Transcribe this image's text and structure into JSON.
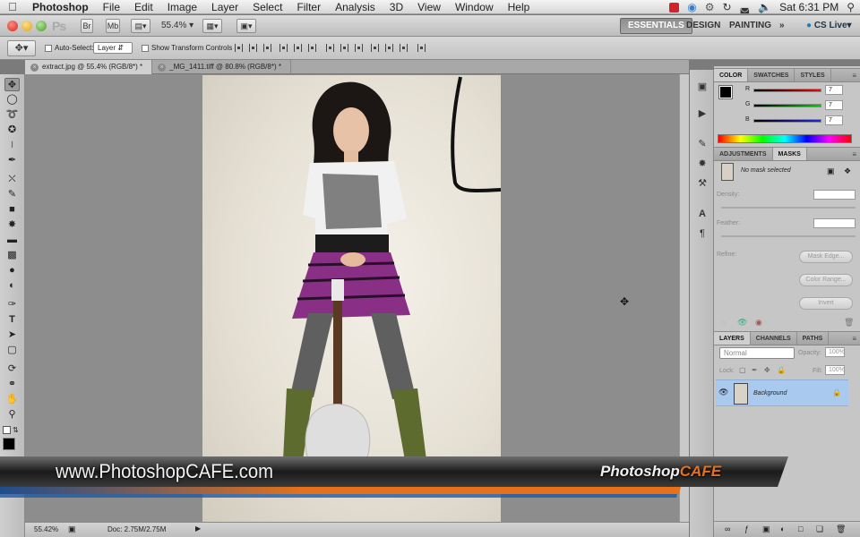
{
  "menubar": {
    "app_name": "Photoshop",
    "items": [
      "File",
      "Edit",
      "Image",
      "Layer",
      "Select",
      "Filter",
      "Analysis",
      "3D",
      "View",
      "Window",
      "Help"
    ],
    "clock": "Sat 6:31 PM"
  },
  "appbar": {
    "logo": "Ps",
    "zoom": "55.4%",
    "br_label": "Br",
    "mb_label": "Mb",
    "workspaces": [
      "ESSENTIALS",
      "DESIGN",
      "PAINTING"
    ],
    "more": "»",
    "cs_live": "CS Live"
  },
  "options": {
    "auto_select": "Auto-Select:",
    "layer_value": "Layer",
    "show_transform": "Show Transform Controls"
  },
  "tabs": [
    {
      "label": "extract.jpg @ 55.4% (RGB/8*) *",
      "active": true
    },
    {
      "label": "_MG_1411.tiff @ 80.8% (RGB/8*) *",
      "active": false
    }
  ],
  "panels": {
    "color_tabs": [
      "COLOR",
      "SWATCHES",
      "STYLES"
    ],
    "channels": [
      {
        "label": "R",
        "value": "7"
      },
      {
        "label": "G",
        "value": "7"
      },
      {
        "label": "B",
        "value": "7"
      }
    ],
    "adj_tabs": [
      "ADJUSTMENTS",
      "MASKS"
    ],
    "mask_status": "No mask selected",
    "density_label": "Density:",
    "feather_label": "Feather:",
    "refine_label": "Refine:",
    "mask_edge": "Mask Edge...",
    "color_range": "Color Range...",
    "invert": "Invert",
    "layers_tabs": [
      "LAYERS",
      "CHANNELS",
      "PATHS"
    ],
    "blend_mode": "Normal",
    "opacity_label": "Opacity:",
    "opacity_value": "100%",
    "lock_label": "Lock:",
    "fill_label": "Fill:",
    "fill_value": "100%",
    "layer_name": "Background"
  },
  "status": {
    "zoom": "55.42%",
    "doc": "Doc: 2.75M/2.75M"
  },
  "banner": {
    "url": "www.PhotoshopCAFE.com",
    "brand_a": "Photoshop",
    "brand_b": "CAFE"
  },
  "colors": {
    "banner_orange": "#e7711b",
    "layer_selected": "#a9c9ee",
    "skirt": "#8a2f86",
    "boots": "#5d6b2e"
  }
}
